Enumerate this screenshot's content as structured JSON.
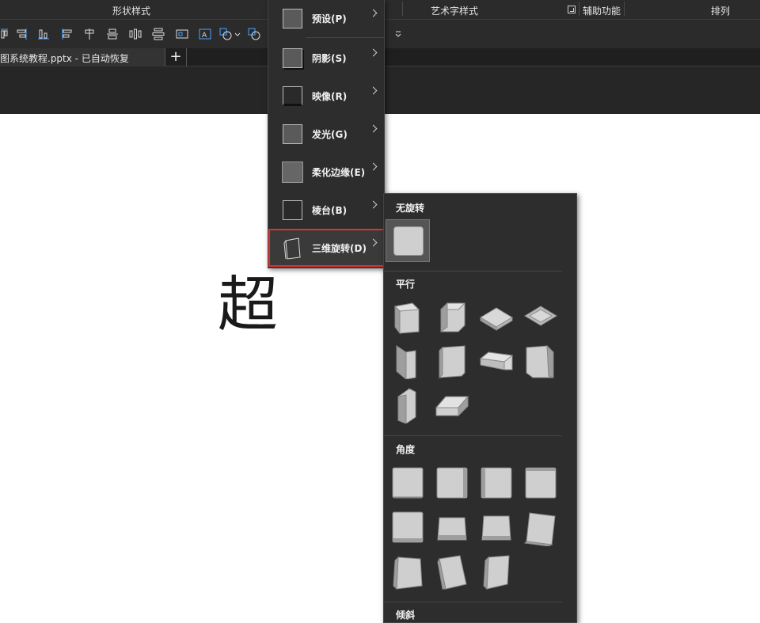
{
  "ribbon": {
    "groups": [
      "形状样式",
      "艺术字样式",
      "辅助功能",
      "排列"
    ]
  },
  "document_tab": {
    "title": "图系统教程.pptx  -  已自动恢复",
    "add_label": "+"
  },
  "slide": {
    "text": "超"
  },
  "effects_menu": {
    "items": [
      {
        "label": "预设(P)",
        "icon": "preset-effect-icon"
      },
      {
        "label": "阴影(S)",
        "icon": "shadow-effect-icon"
      },
      {
        "label": "映像(R)",
        "icon": "reflection-effect-icon"
      },
      {
        "label": "发光(G)",
        "icon": "glow-effect-icon"
      },
      {
        "label": "柔化边缘(E)",
        "icon": "soft-edges-effect-icon"
      },
      {
        "label": "棱台(B)",
        "icon": "bevel-effect-icon"
      },
      {
        "label": "三维旋转(D)",
        "icon": "3d-rotation-effect-icon",
        "selected": true
      }
    ]
  },
  "rotation_gallery": {
    "sections": [
      {
        "title": "无旋转",
        "count": 1
      },
      {
        "title": "平行",
        "count": 10
      },
      {
        "title": "角度",
        "count": 11
      },
      {
        "title": "倾斜",
        "count": 0
      }
    ]
  },
  "colors": {
    "ribbon_bg": "#2b2b2b",
    "menu_bg": "#2d2d2d",
    "selected_border": "#e03131",
    "shape_fill": "#cfcfcf"
  }
}
